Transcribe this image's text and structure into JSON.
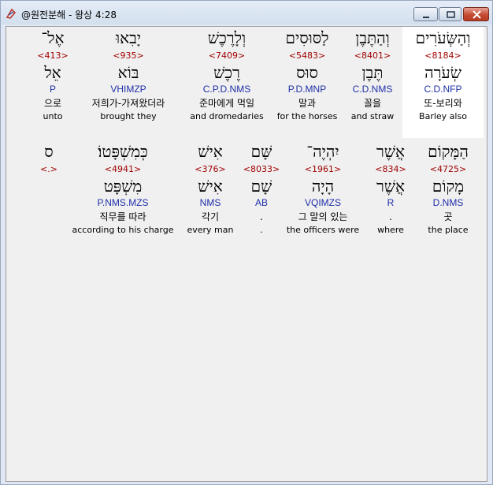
{
  "window": {
    "title": "@원전분해 - 왕상 4:28",
    "controls": {
      "minimize": "minimize-icon",
      "maximize": "maximize-icon",
      "close": "close-icon"
    }
  },
  "rows": [
    {
      "words": [
        {
          "hebrew": "וְהַשְּׂעֹרִים",
          "strong": "<8184>",
          "lexeme": "שְׂעֹרָה",
          "morph": "C.D.NFP",
          "korean": "또-보리와",
          "english": "Barley also",
          "selected": true
        },
        {
          "hebrew": "וְהַתֶּבֶן",
          "strong": "<8401>",
          "lexeme": "תֶּבֶן",
          "morph": "C.D.NMS",
          "korean": "꼴을",
          "english": "and straw"
        },
        {
          "hebrew": "לַסּוּסִים",
          "strong": "<5483>",
          "lexeme": "סוּס",
          "morph": "P.D.MNP",
          "korean": "말과",
          "english": "for the horses"
        },
        {
          "hebrew": "וְלָרֶכֶשׁ",
          "strong": "<7409>",
          "lexeme": "רֶכֶשׁ",
          "morph": "C.P.D.NMS",
          "korean": "준마에게 먹일",
          "english": "and dromedaries"
        },
        {
          "hebrew": "יָבִאוּ",
          "strong": "<935>",
          "lexeme": "בּוֹא",
          "morph": "VHIMZP",
          "korean": "저희가-가져왔더라",
          "english": "brought they"
        },
        {
          "hebrew": "אֶל־",
          "strong": "<413>",
          "lexeme": "אֵל",
          "morph": "P",
          "korean": "으로",
          "english": "unto"
        }
      ]
    },
    {
      "words": [
        {
          "hebrew": "הַמָּקוֹם",
          "strong": "<4725>",
          "lexeme": "מָקוֹם",
          "morph": "D.NMS",
          "korean": "곳",
          "english": "the place"
        },
        {
          "hebrew": "אֲשֶׁר",
          "strong": "<834>",
          "lexeme": "אֲשֶׁר",
          "morph": "R",
          "korean": ".",
          "english": "where"
        },
        {
          "hebrew": "יִהְיֶה־",
          "strong": "<1961>",
          "lexeme": "הָיָה",
          "morph": "VQIMZS",
          "korean": "그 말의 있는",
          "english": "the officers were"
        },
        {
          "hebrew": "שָּׁם",
          "strong": "<8033>",
          "lexeme": "שָׁם",
          "morph": "AB",
          "korean": ".",
          "english": "."
        },
        {
          "hebrew": "אִישׁ",
          "strong": "<376>",
          "lexeme": "אִישׁ",
          "morph": "NMS",
          "korean": "각기",
          "english": "every man"
        },
        {
          "hebrew": "כְּמִשְׁפָּטוֹ׃",
          "strong": "<4941>",
          "lexeme": "מִשְׁפָּט",
          "morph": "P.NMS.MZS",
          "korean": "직무를 따라",
          "english": "according to his charge"
        },
        {
          "hebrew": "ס",
          "strong": "<.>",
          "lexeme": "",
          "morph": "",
          "korean": "",
          "english": ""
        }
      ]
    }
  ],
  "colors": {
    "strong": "#a00000",
    "morph": "#1f2fa8",
    "selected_bg": "#ffffff",
    "client_bg": "#f0f0f0"
  }
}
